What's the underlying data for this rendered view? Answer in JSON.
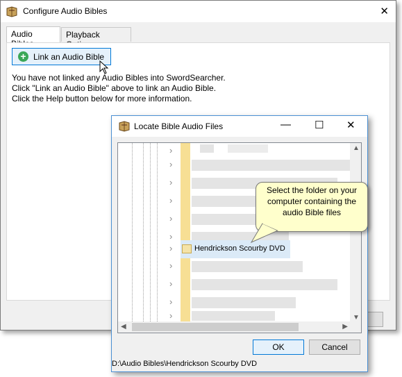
{
  "main_window": {
    "title": "Configure Audio Bibles",
    "close_glyph": "✕",
    "tabs": [
      {
        "label": "Audio Bibles",
        "active": true
      },
      {
        "label": "Playback Options",
        "active": false
      }
    ],
    "link_button_label": "Link an Audio Bible",
    "info_lines": [
      "You have not linked any Audio Bibles into SwordSearcher.",
      "Click \"Link an Audio Bible\" above to link an Audio Bible.",
      "Click the Help button below for more information."
    ]
  },
  "locate_dialog": {
    "title": "Locate Bible Audio Files",
    "minimize_glyph": "—",
    "maximize_glyph": "☐",
    "close_glyph": "✕",
    "selected_folder": "Hendrickson Scourby DVD",
    "ok_label": "OK",
    "cancel_label": "Cancel",
    "status_path": "D:\\Audio Bibles\\Hendrickson Scourby DVD"
  },
  "callout": {
    "text": "Select the folder on your computer containing the audio Bible files"
  },
  "icons": {
    "app": "swordsearcher-icon",
    "add": "plus-circle-icon",
    "cursor": "mouse-pointer-icon",
    "folder": "folder-icon"
  },
  "colors": {
    "accent_border": "#0078d7",
    "button_hover": "#e5f1fb",
    "selection": "#dbeaf7",
    "folder": "#f7df94",
    "callout": "#ffffcc",
    "add_icon": "#3aa757"
  }
}
